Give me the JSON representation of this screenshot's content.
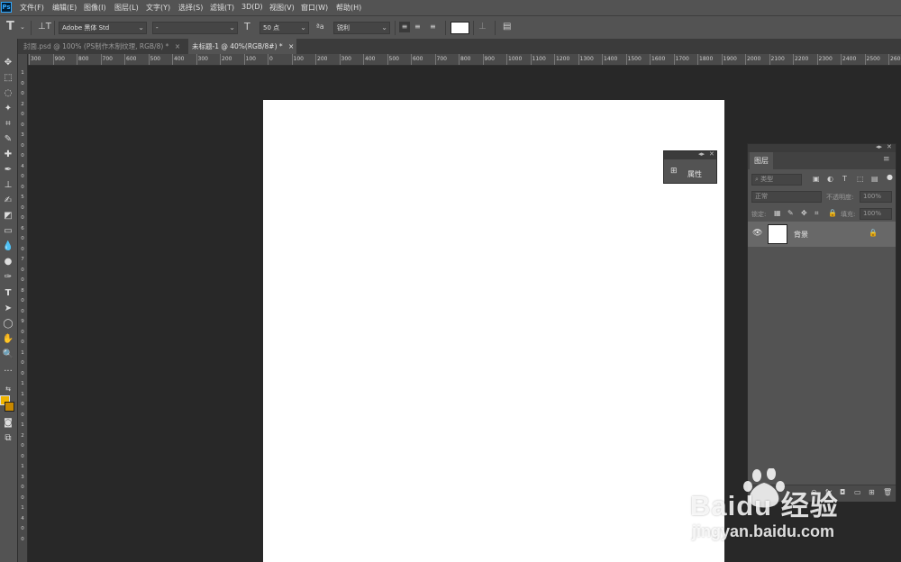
{
  "app": {
    "logo": "Ps"
  },
  "menu": [
    "文件(F)",
    "编辑(E)",
    "图像(I)",
    "图层(L)",
    "文字(Y)",
    "选择(S)",
    "滤镜(T)",
    "3D(D)",
    "视图(V)",
    "窗口(W)",
    "帮助(H)"
  ],
  "options": {
    "tool_icon": "T",
    "font_family": "Adobe 黑体 Std",
    "font_style": "-",
    "font_size": "50 点",
    "aa_label": "ªa",
    "antialias": "锐利",
    "text_color": "#ffffff"
  },
  "tabs": [
    {
      "label": "封面.psd @ 100% (PS制作木制纹理, RGB/8) *",
      "close": "×",
      "active": false
    },
    {
      "label": "未标题-1 @ 40%(RGB/8#) *",
      "close": "×",
      "active": true
    }
  ],
  "ruler": {
    "top_labels": [
      "300",
      "900",
      "800",
      "700",
      "600",
      "500",
      "400",
      "300",
      "200",
      "100",
      "0",
      "100",
      "200",
      "300",
      "400",
      "500",
      "600",
      "700",
      "800",
      "900",
      "1000",
      "1100",
      "1200",
      "1300",
      "1400",
      "1500",
      "1600",
      "1700",
      "1800",
      "1900",
      "2000",
      "2100",
      "2200",
      "2300",
      "2400",
      "2500",
      "2600"
    ],
    "left_labels": [
      "1",
      "0",
      "0",
      "2",
      "0",
      "0",
      "3",
      "0",
      "0",
      "4",
      "0",
      "0",
      "5",
      "0",
      "0",
      "6",
      "0",
      "0",
      "7",
      "0",
      "0",
      "8",
      "0",
      "0",
      "9",
      "0",
      "0",
      "1",
      "0",
      "0",
      "1",
      "1",
      "0",
      "0",
      "1",
      "2",
      "0",
      "0",
      "1",
      "3",
      "0",
      "0",
      "1",
      "4",
      "0",
      "0"
    ]
  },
  "properties_panel": {
    "label": "属性"
  },
  "layers_panel": {
    "tab": "图层",
    "filter_placeholder": "类型",
    "blend_mode": "正常",
    "opacity_label": "不透明度:",
    "opacity_value": "100%",
    "lock_label": "锁定:",
    "fill_label": "填充:",
    "fill_value": "100%",
    "layers": [
      {
        "name": "背景",
        "visible": true,
        "locked": true
      }
    ]
  },
  "watermark": {
    "brand": "Baidu 经验",
    "url": "jingyan.baidu.com"
  },
  "colors": {
    "foreground": "#f0b400",
    "background": "#c78800",
    "canvas": "#ffffff",
    "workspace": "#282828"
  }
}
